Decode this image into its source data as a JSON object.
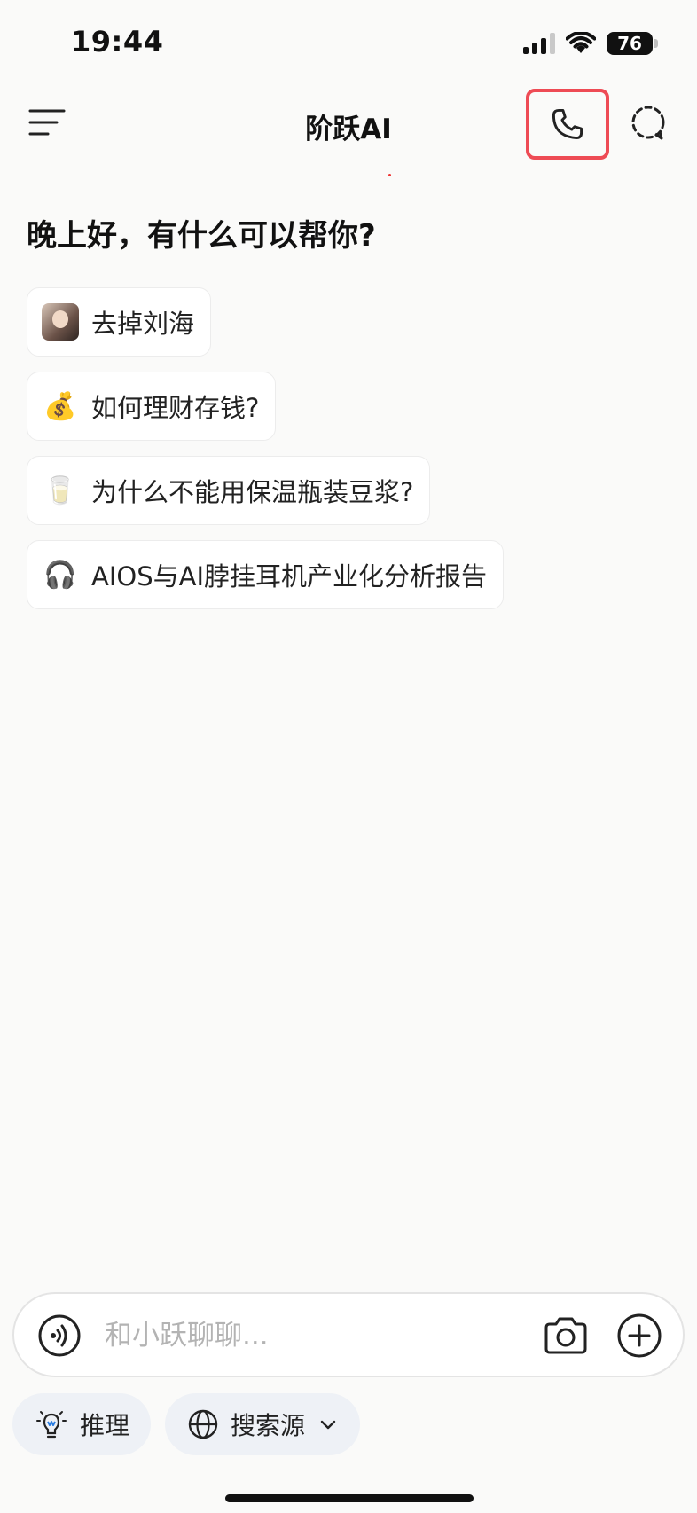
{
  "status_bar": {
    "time": "19:44",
    "battery": "76"
  },
  "header": {
    "title": "阶跃AI",
    "icons": {
      "menu": "menu-icon",
      "call": "phone-icon",
      "new_chat": "new-chat-icon"
    },
    "highlight_color": "#ee4b55"
  },
  "greeting": "晚上好，有什么可以帮你?",
  "suggestions": [
    {
      "icon": "avatar-thumbnail",
      "label": "去掉刘海"
    },
    {
      "icon": "💰",
      "label": "如何理财存钱?"
    },
    {
      "icon": "🥛",
      "label": "为什么不能用保温瓶装豆浆?"
    },
    {
      "icon": "🎧",
      "label": "AIOS与AI脖挂耳机产业化分析报告"
    }
  ],
  "composer": {
    "placeholder": "和小跃聊聊..."
  },
  "toolbar": {
    "reasoning_label": "推理",
    "search_source_label": "搜索源"
  }
}
